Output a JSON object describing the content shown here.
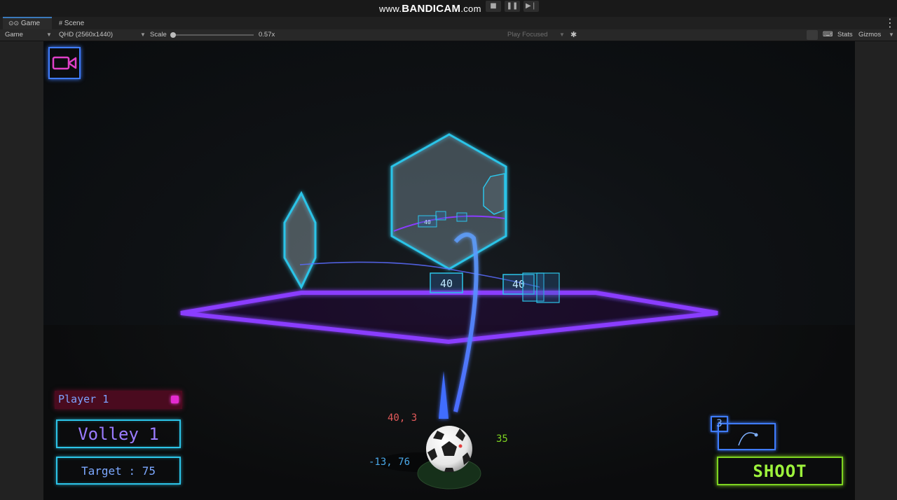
{
  "recording": {
    "watermark_prefix": "www.",
    "watermark_brand": "BANDICAM",
    "watermark_suffix": ".com"
  },
  "tabs": [
    {
      "label": "Game",
      "icon": "gamepad-icon",
      "active": true
    },
    {
      "label": "Scene",
      "icon": "grid-icon",
      "active": false
    }
  ],
  "toolbar": {
    "display": "Game",
    "resolution": "QHD (2560x1440)",
    "scale_label": "Scale",
    "scale_value": "0.57x",
    "play_mode": "Play Focused",
    "stats_label": "Stats",
    "gizmos_label": "Gizmos"
  },
  "scene": {
    "target_labels": [
      "40",
      "40",
      "40"
    ]
  },
  "hud": {
    "player_label": "Player 1",
    "volley_label": "Volley 1",
    "target_label": "Target : 75",
    "stat_red": "40, 3",
    "stat_green": "35",
    "stat_blue": "-13, 76",
    "trajectory_count": "3",
    "shoot_label": "SHOOT"
  },
  "colors": {
    "neon_cyan": "#2cc4e8",
    "neon_purple": "#8a3cff",
    "neon_blue": "#3f7cff",
    "neon_green": "#7ed321",
    "player_pink": "#e42bd0"
  }
}
